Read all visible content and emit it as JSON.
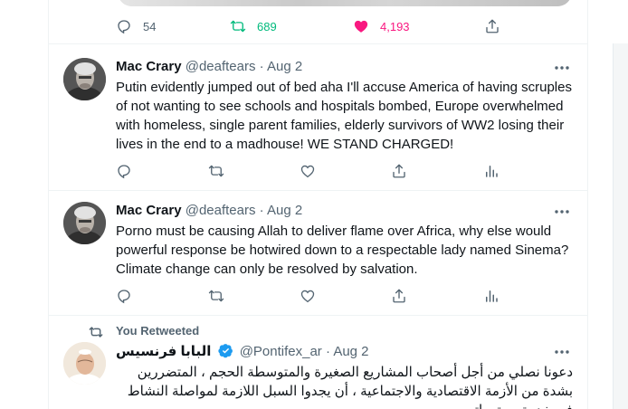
{
  "prev_tweet": {
    "replies": "54",
    "retweets": "689",
    "likes": "4,193"
  },
  "tweets": [
    {
      "name": "Mac Crary",
      "handle": "@deaftears",
      "date": "Aug 2",
      "separator": "·",
      "text": "Putin evidently jumped out of bed aha I'll accuse America of having scruples of not wanting to see schools and hospitals bombed, Europe overwhelmed with homeless, single parent families, elderly survivors of WW2 losing their lives in the end to a madhouse!  WE STAND CHARGED!"
    },
    {
      "name": "Mac Crary",
      "handle": "@deaftears",
      "date": "Aug 2",
      "separator": "·",
      "text": "Porno must be causing Allah to deliver flame over Africa, why else would powerful response be hotwired down to a respectable lady named Sinema? Climate change can only be resolved by salvation."
    },
    {
      "retweet_label": "You Retweeted",
      "name": "البابا فرنسيس",
      "handle": "@Pontifex_ar",
      "date": "Aug 2",
      "separator": "·",
      "text_lines": [
        "دعونا نصلي من أجل أصحاب المشاريع الصغيرة والمتوسطة الحجم ، المتضررين",
        "بشدة من الأزمة الاقتصادية والاجتماعية ، أن يجدوا السبل اللازمة لمواصلة النشاط",
        "في خدمة مجتمعاتهم"
      ]
    }
  ],
  "colors": {
    "retweet_green": "#00ba7c",
    "like_pink": "#f91880",
    "verified_blue": "#1d9bf0",
    "muted": "#536471"
  },
  "icons": [
    "reply-icon",
    "retweet-icon",
    "like-icon",
    "share-icon",
    "analytics-icon",
    "more-icon",
    "verified-icon"
  ]
}
